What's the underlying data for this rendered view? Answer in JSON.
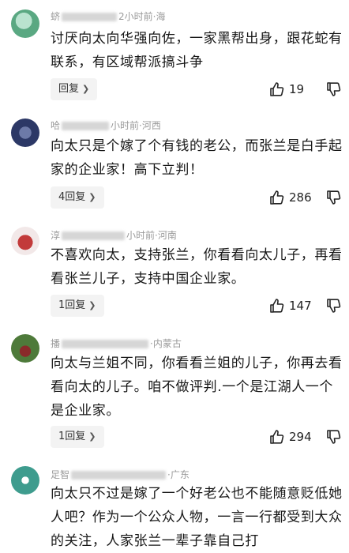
{
  "comments": [
    {
      "meta_prefix": "蛴",
      "meta_mid": "2小时前",
      "meta_suffix": "·海",
      "text": "讨厌向太向华强向佐，一家黑帮出身，跟花蛇有联系，有区域帮派搞斗争",
      "reply_label": "回复",
      "likes": "19"
    },
    {
      "meta_prefix": "哈",
      "meta_mid": "小时前",
      "meta_suffix": "·河西",
      "text": "向太只是个嫁了个有钱的老公，而张兰是白手起家的企业家！高下立判！",
      "reply_label": "4回复",
      "likes": "286"
    },
    {
      "meta_prefix": "淳",
      "meta_mid": "小时前",
      "meta_suffix": "·河南",
      "text": "不喜欢向太，支持张兰，你看看向太儿子，再看看张兰儿子，支持中国企业家。",
      "reply_label": "1回复",
      "likes": "147"
    },
    {
      "meta_prefix": "播",
      "meta_mid": "",
      "meta_suffix": "·内蒙古",
      "text": "向太与兰姐不同，你看看兰姐的儿子，你再去看看向太的儿子。咱不做评判.一个是江湖人一个是企业家。",
      "reply_label": "1回复",
      "likes": "294"
    },
    {
      "meta_prefix": "足智",
      "meta_mid": "",
      "meta_suffix": "·广东",
      "text": "向太只不过是嫁了一个好老公也不能随意贬低她人吧？作为一个公众人物，一言一行都受到大众的关注，人家张兰一辈子靠自己打",
      "reply_label": "",
      "likes": ""
    }
  ],
  "icons": {
    "like": "thumb-up-icon",
    "dislike": "thumb-down-icon",
    "chevron": "chevron-right-icon"
  }
}
